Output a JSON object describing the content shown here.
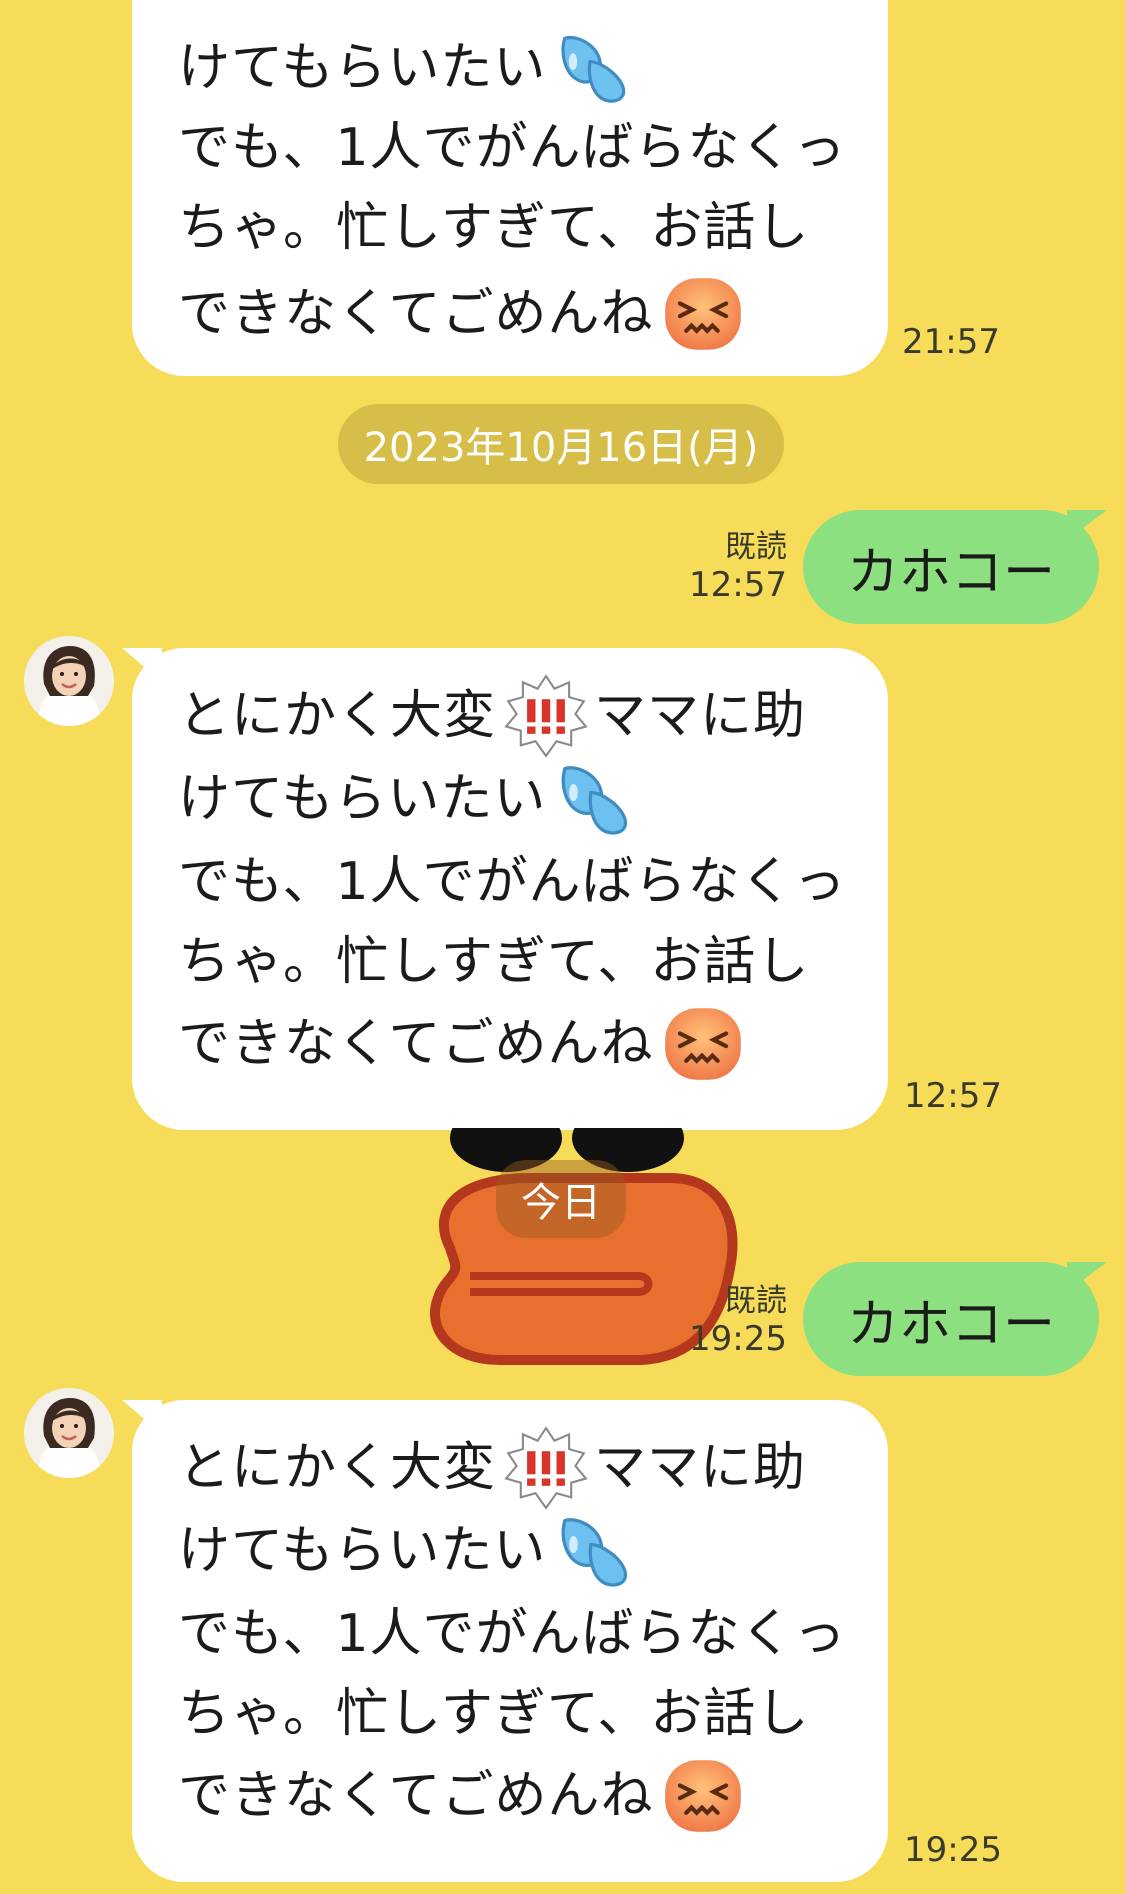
{
  "messages_in": [
    {
      "lines": [
        "けてもらいたい",
        "でも、1人でがんばらなくっ",
        "ちゃ。忙しすぎて、お話し",
        "できなくてごめんね"
      ],
      "time": "21:57"
    },
    {
      "lines": [
        "とにかく大変",
        "ママに助",
        "けてもらいたい",
        "でも、1人でがんばらなくっ",
        "ちゃ。忙しすぎて、お話し",
        "できなくてごめんね"
      ],
      "time": "12:57"
    },
    {
      "lines": [
        "とにかく大変",
        "ママに助",
        "けてもらいたい",
        "でも、1人でがんばらなくっ",
        "ちゃ。忙しすぎて、お話し",
        "できなくてごめんね"
      ],
      "time": "19:25"
    }
  ],
  "messages_out": [
    {
      "text": "カホコー",
      "read_label": "既読",
      "time": "12:57"
    },
    {
      "text": "カホコー",
      "read_label": "既読",
      "time": "19:25"
    }
  ],
  "date_separator": "2023年10月16日(月)",
  "today_separator": "今日",
  "icons": {
    "sweat": "sweat-droplets-icon",
    "confounded": "confounded-face-icon",
    "exclamation": "double-exclamation-icon",
    "avatar": "user-avatar",
    "sticker": "duck-beak-sticker"
  },
  "colors": {
    "background": "#f6dc58",
    "incoming_bubble": "#ffffff",
    "outgoing_bubble": "#8de07f"
  }
}
